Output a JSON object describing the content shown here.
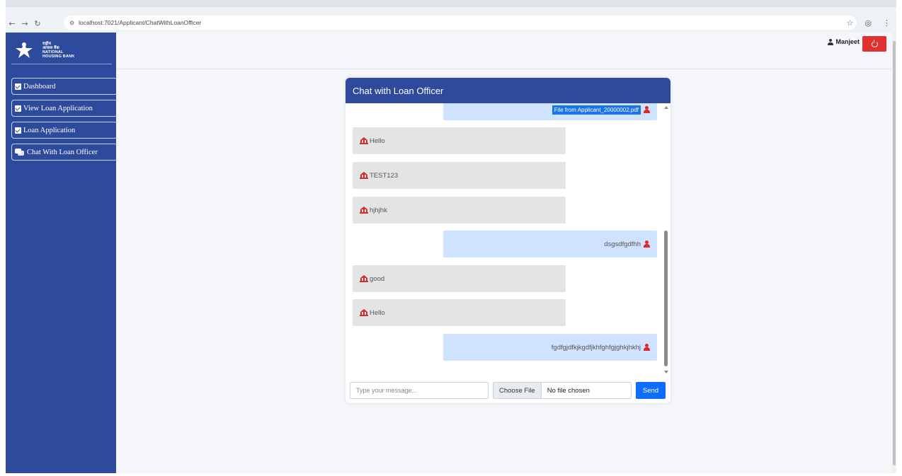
{
  "browser": {
    "url": "localhost:7021/Applicant/ChatWithLoanOfficer"
  },
  "sidebar": {
    "logo_text_lines": [
      "राष्ट्रीय",
      "आवास बैंक",
      "NATIONAL",
      "HOUSING BANK"
    ],
    "items": [
      {
        "label": "Dashboard",
        "icon": "check-square-icon"
      },
      {
        "label": "View Loan Application",
        "icon": "check-square-icon"
      },
      {
        "label": "Loan Application",
        "icon": "check-square-icon"
      },
      {
        "label": "Chat With Loan Officer",
        "icon": "comments-icon"
      }
    ]
  },
  "header": {
    "user_name": "Manjeet",
    "accent": "#e03131"
  },
  "chat": {
    "title": "Chat with Loan Officer",
    "file_link_text": "File from Applicant_20000002.pdf",
    "messages": [
      {
        "direction": "in",
        "text": "Hello"
      },
      {
        "direction": "in",
        "text": "TEST123"
      },
      {
        "direction": "in",
        "text": "hjhjhk"
      },
      {
        "direction": "out",
        "text": "dsgsdfgdfhh"
      },
      {
        "direction": "in",
        "text": "good"
      },
      {
        "direction": "in",
        "text": "Hello"
      },
      {
        "direction": "out",
        "text": "fgdfgjdfkjkgdfjkhfghfgjghkjhkhj"
      }
    ],
    "input_placeholder": "Type your message...",
    "choose_file_label": "Choose File",
    "no_file_text": "No file chosen",
    "send_label": "Send"
  },
  "colors": {
    "sidebar": "#2e4a9c",
    "incoming_bubble": "#e3e4e6",
    "outgoing_bubble": "#cfe2ff",
    "send_button": "#0d6efd"
  }
}
